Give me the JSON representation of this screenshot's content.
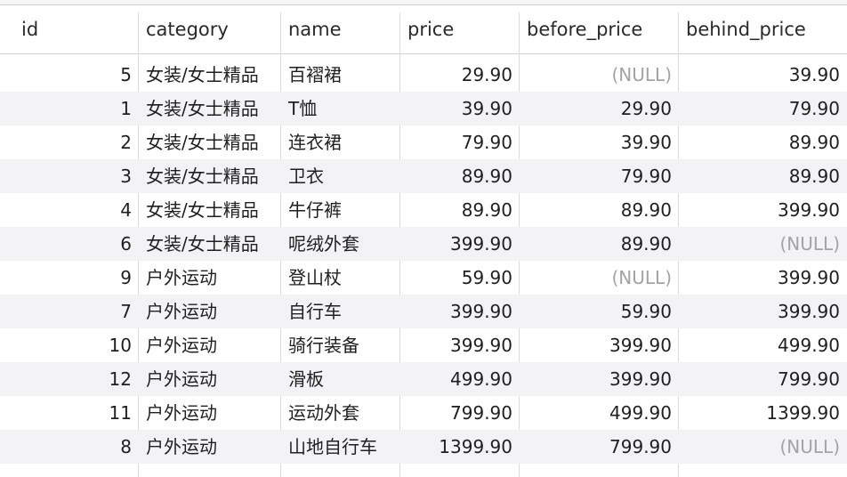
{
  "columns": [
    "id",
    "category",
    "name",
    "price",
    "before_price",
    "behind_price"
  ],
  "rows": [
    {
      "id": "5",
      "category": "女装/女士精品",
      "name": "百褶裙",
      "price": "29.90",
      "before_price": "(NULL)",
      "behind_price": "39.90"
    },
    {
      "id": "1",
      "category": "女装/女士精品",
      "name": "T恤",
      "price": "39.90",
      "before_price": "29.90",
      "behind_price": "79.90"
    },
    {
      "id": "2",
      "category": "女装/女士精品",
      "name": "连衣裙",
      "price": "79.90",
      "before_price": "39.90",
      "behind_price": "89.90"
    },
    {
      "id": "3",
      "category": "女装/女士精品",
      "name": "卫衣",
      "price": "89.90",
      "before_price": "79.90",
      "behind_price": "89.90"
    },
    {
      "id": "4",
      "category": "女装/女士精品",
      "name": "牛仔裤",
      "price": "89.90",
      "before_price": "89.90",
      "behind_price": "399.90"
    },
    {
      "id": "6",
      "category": "女装/女士精品",
      "name": "呢绒外套",
      "price": "399.90",
      "before_price": "89.90",
      "behind_price": "(NULL)"
    },
    {
      "id": "9",
      "category": "户外运动",
      "name": "登山杖",
      "price": "59.90",
      "before_price": "(NULL)",
      "behind_price": "399.90"
    },
    {
      "id": "7",
      "category": "户外运动",
      "name": "自行车",
      "price": "399.90",
      "before_price": "59.90",
      "behind_price": "399.90"
    },
    {
      "id": "10",
      "category": "户外运动",
      "name": "骑行装备",
      "price": "399.90",
      "before_price": "399.90",
      "behind_price": "499.90"
    },
    {
      "id": "12",
      "category": "户外运动",
      "name": "滑板",
      "price": "499.90",
      "before_price": "399.90",
      "behind_price": "799.90"
    },
    {
      "id": "11",
      "category": "户外运动",
      "name": "运动外套",
      "price": "799.90",
      "before_price": "499.90",
      "behind_price": "1399.90"
    },
    {
      "id": "8",
      "category": "户外运动",
      "name": "山地自行车",
      "price": "1399.90",
      "before_price": "799.90",
      "behind_price": "(NULL)"
    }
  ]
}
